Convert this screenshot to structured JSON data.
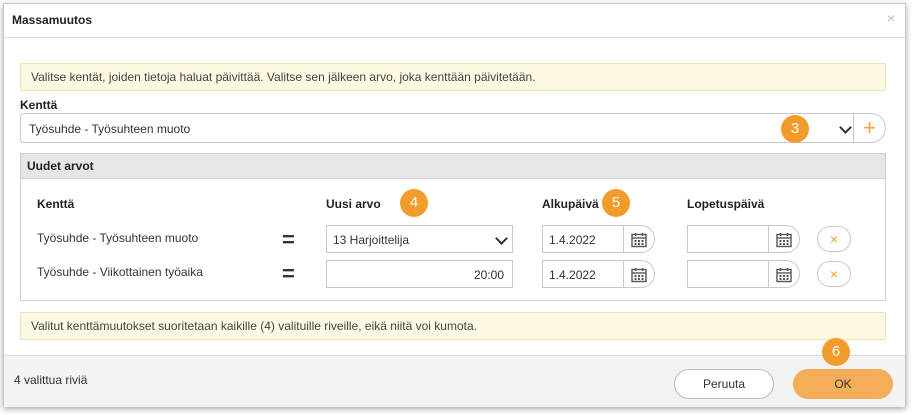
{
  "dialog": {
    "title": "Massamuutos",
    "close_glyph": "×",
    "info_top": "Valitse kentät, joiden tietoja haluat päivittää. Valitse sen jälkeen arvo, joka kenttään päivitetään.",
    "field_label": "Kenttä",
    "field_value": "Työsuhde - Työsuhteen muoto",
    "add_glyph": "+",
    "badges": [
      "3",
      "4",
      "5",
      "6"
    ]
  },
  "panel": {
    "title": "Uudet arvot",
    "columns": {
      "field": "Kenttä",
      "new_value": "Uusi arvo",
      "start_date": "Alkupäivä",
      "end_date": "Lopetuspäivä"
    },
    "rows": [
      {
        "field": "Työsuhde - Työsuhteen muoto",
        "eq": "=",
        "new_value": "13 Harjoittelija",
        "start_date": "1.4.2022",
        "end_date": "",
        "remove_glyph": "×"
      },
      {
        "field": "Työsuhde - Viikottainen työaika",
        "eq": "=",
        "new_value": "20:00",
        "start_date": "1.4.2022",
        "end_date": "",
        "remove_glyph": "×"
      }
    ]
  },
  "info_bottom": "Valitut kenttämuutokset suoritetaan kaikille (4) valituille riveille, eikä niitä voi kumota.",
  "footer": {
    "selected_count": "4 valittua riviä",
    "cancel_label": "Peruuta",
    "ok_label": "OK"
  },
  "colors": {
    "accent": "#f39b2b",
    "ok_button": "#f4ad58",
    "info_bg": "#fdf8e1"
  },
  "icons": [
    "close-icon",
    "chevron-down-icon",
    "plus-icon",
    "calendar-icon",
    "remove-icon"
  ]
}
